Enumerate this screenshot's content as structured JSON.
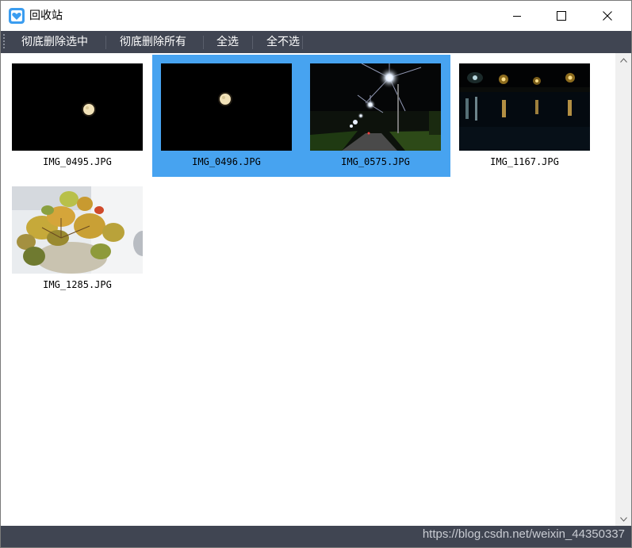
{
  "window": {
    "title": "回收站",
    "accent": "#3b9df0"
  },
  "toolbar": {
    "items": [
      {
        "label": "彻底删除选中"
      },
      {
        "label": "彻底删除所有"
      },
      {
        "label": "全选"
      },
      {
        "label": "全不选"
      }
    ],
    "background": "#404552"
  },
  "gallery": {
    "selection_color": "#47a3f0",
    "items": [
      {
        "filename": "IMG_0495.JPG",
        "selected": false,
        "image": "moon-night-photo"
      },
      {
        "filename": "IMG_0496.JPG",
        "selected": true,
        "image": "moon-night-photo"
      },
      {
        "filename": "IMG_0575.JPG",
        "selected": true,
        "image": "street-lights-photo"
      },
      {
        "filename": "IMG_1167.JPG",
        "selected": false,
        "image": "lake-night-lights-photo"
      },
      {
        "filename": "IMG_1285.JPG",
        "selected": false,
        "image": "potted-plant-photo"
      }
    ]
  },
  "footer": {
    "watermark": "https://blog.csdn.net/weixin_44350337"
  }
}
